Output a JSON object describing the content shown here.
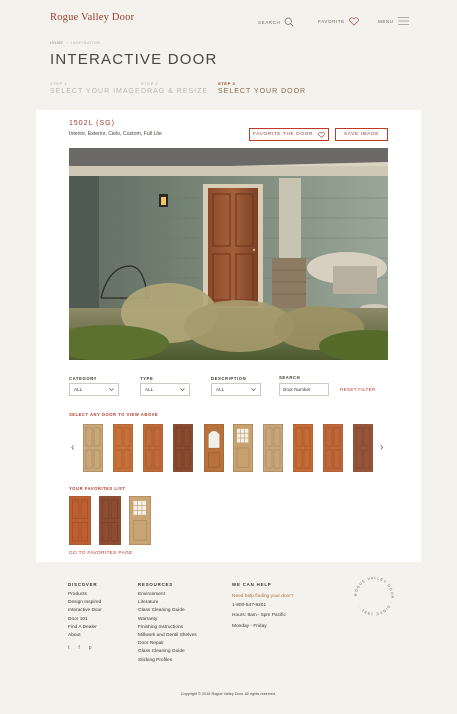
{
  "header": {
    "logo": "Rogue Valley Door",
    "search_label": "SEARCH",
    "favorite_label": "FAVORITE",
    "menu_label": "MENU"
  },
  "breadcrumb": {
    "home": "HOME",
    "current": "INSPIRATION"
  },
  "page_title": "INTERACTIVE DOOR",
  "steps": [
    {
      "num": "STEP 1",
      "label": "SELECT YOUR IMAGE"
    },
    {
      "num": "STEP 2",
      "label": "DRAG & RESIZE"
    },
    {
      "num": "STEP 3",
      "label": "SELECT YOUR DOOR"
    }
  ],
  "selected_door": {
    "code": "1502L (SG)",
    "tags": "Interior, Exterior, Cielo, Custom, Full Lite",
    "favorite_button": "FAVORITE THE DOOR",
    "save_button": "SAVE IMAGE"
  },
  "filters": {
    "category": {
      "label": "CATEGORY",
      "value": "ALL"
    },
    "type": {
      "label": "TYPE",
      "value": "ALL"
    },
    "description": {
      "label": "DESCRIPTION",
      "value": "ALL"
    },
    "search": {
      "label": "SEARCH",
      "placeholder": "Door Number"
    },
    "reset": "RESET FILTER"
  },
  "select_heading": "SELECT ANY DOOR TO VIEW ABOVE",
  "door_thumbs": [
    {
      "style": "panel-light",
      "color": "#c9a777"
    },
    {
      "style": "panel-orange",
      "color": "#c8713a"
    },
    {
      "style": "panel-orange",
      "color": "#c06a3a"
    },
    {
      "style": "panel-dark",
      "color": "#8a4a30"
    },
    {
      "style": "arch-glass",
      "color": "#b8733d"
    },
    {
      "style": "lite-glass",
      "color": "#c9a070"
    },
    {
      "style": "panel-light",
      "color": "#c8a67a"
    },
    {
      "style": "panel-orange",
      "color": "#c56b34"
    },
    {
      "style": "panel-orange",
      "color": "#c0663a"
    },
    {
      "style": "panel-dark",
      "color": "#98543a"
    }
  ],
  "favorites_heading": "YOUR FAVORITES LIST",
  "favorites": [
    {
      "style": "panel-orange",
      "color": "#bd5f30"
    },
    {
      "style": "panel-dark",
      "color": "#8e4c32"
    },
    {
      "style": "lite-glass",
      "color": "#c9a575"
    }
  ],
  "go_to_favorites": "GO TO FAVORITES PAGE",
  "footer": {
    "discover": {
      "heading": "DISCOVER",
      "links": [
        "Products",
        "Design Inspired",
        "Interactive Door",
        "Door 101",
        "Find A Dealer",
        "About"
      ]
    },
    "resources": {
      "heading": "RESOURCES",
      "links": [
        "Environment",
        "Literature",
        "Glass Cleaning Guide",
        "Warranty",
        "Finishing Instructions",
        "Millwork and Dentil Shelves",
        "Door Repair",
        "Glass Cleaning Guide",
        "Sticking Profiles"
      ]
    },
    "help": {
      "heading": "WE CAN HELP",
      "prompt": "Need help finding your door?",
      "phone": "1-800-547-9201",
      "hours": "Hours: 8am - 5pm Pacific",
      "days": "Monday - Friday"
    },
    "seal_text": "ROGUE VALLEY DOOR · SINCE 1981 ·",
    "social_icons": [
      "twitter-icon",
      "facebook-icon",
      "pinterest-icon"
    ],
    "copyright": "Copyright © 2016 Rogue Valley Door. All rights reserved."
  },
  "colors": {
    "accent": "#9b3a2c",
    "background": "#f4f2ec",
    "card": "#ffffff"
  }
}
